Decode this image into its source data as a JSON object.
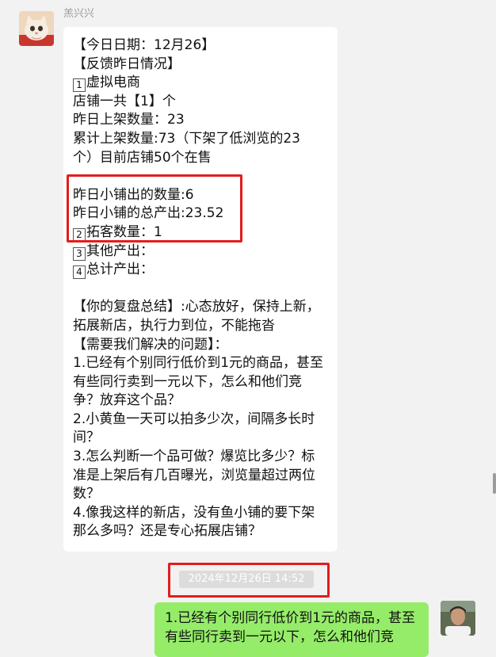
{
  "chat": {
    "sender_name": "羔兴兴",
    "message_lines": [
      "【今日日期：12月26】",
      "【反馈昨日情况】",
      "1虚拟电商",
      "店铺一共【1】个",
      "昨日上架数量：23",
      "累计上架数量:73（下架了低浏览的23",
      "个）目前店铺50个在售",
      "",
      "昨日小铺出的数量:6",
      "昨日小铺的总产出:23.52",
      "2拓客数量：1",
      "3其他产出：",
      "4总计产出：",
      "",
      "【你的复盘总结】:心态放好，保持上新，",
      "拓展新店，执行力到位，不能拖沓",
      "【需要我们解决的问题】：",
      "1.已经有个别同行低价到1元的商品，甚至",
      "有些同行卖到一元以下，怎么和他们竞",
      "争？放弃这个品？",
      "2.小黄鱼一天可以拍多少次，间隔多长时",
      "间？",
      "3.怎么判断一个品可做？爆览比多少？标",
      "准是上架后有几百曝光，浏览量超过两位",
      "数？",
      "4.像我这样的新店，没有鱼小铺的要下架",
      "那么多吗？还是专心拓展店铺？"
    ],
    "timestamp": "2024年12月26日 14:52",
    "reply_lines": [
      "1.已经有个别同行低价到1元的商品，甚至",
      "有些同行卖到一元以下，怎么和他们竞"
    ]
  },
  "colors": {
    "highlight": "#e51c1c",
    "outgoing_bubble": "#95ec69",
    "incoming_bubble": "#ffffff"
  }
}
